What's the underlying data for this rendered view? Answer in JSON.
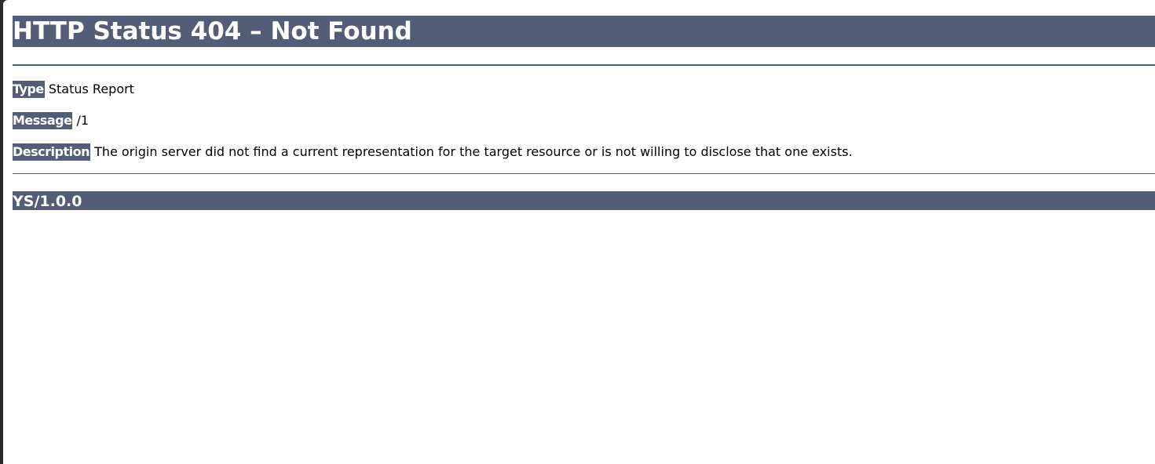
{
  "page": {
    "title": "HTTP Status 404 – Not Found",
    "type_label": "Type",
    "type_value": "Status Report",
    "message_label": "Message",
    "message_value": "/1",
    "description_label": "Description",
    "description_value": "The origin server did not find a current representation for the target resource or is not willing to disclose that one exists.",
    "server_info": "YS/1.0.0"
  },
  "colors": {
    "header_background": "#525d76",
    "header_text": "#ffffff",
    "page_background": "#ffffff",
    "body_text": "#000000"
  }
}
